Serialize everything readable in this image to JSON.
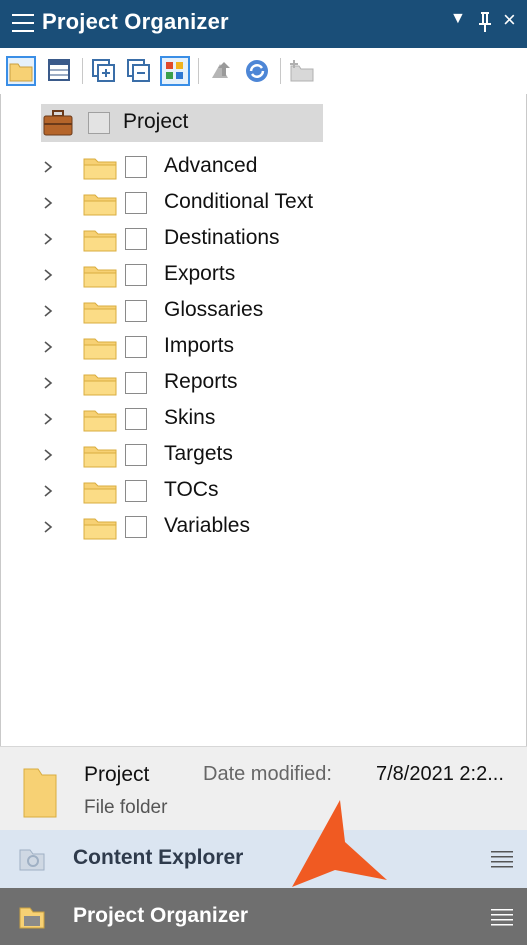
{
  "window": {
    "title": "Project Organizer",
    "dropdown_glyph": "▼",
    "pin_glyph": "⊥",
    "close_glyph": "×"
  },
  "toolbar": {
    "buttons": [
      "open-folder-icon",
      "table-icon",
      "expand-all-icon",
      "collapse-all-icon",
      "color-grid-icon",
      "upload-icon",
      "refresh-icon",
      "new-folder-icon"
    ]
  },
  "tree": {
    "root": {
      "label": "Project"
    },
    "items": [
      {
        "label": "Advanced"
      },
      {
        "label": "Conditional Text"
      },
      {
        "label": "Destinations"
      },
      {
        "label": "Exports"
      },
      {
        "label": "Glossaries"
      },
      {
        "label": "Imports"
      },
      {
        "label": "Reports"
      },
      {
        "label": "Skins"
      },
      {
        "label": "Targets"
      },
      {
        "label": "TOCs"
      },
      {
        "label": "Variables"
      }
    ]
  },
  "details": {
    "name": "Project",
    "date_label": "Date modified:",
    "date_value": "7/8/2021 2:2...",
    "type": "File folder"
  },
  "panes": [
    {
      "label": "Content Explorer",
      "icon": "content-explorer-icon"
    },
    {
      "label": "Project Organizer",
      "icon": "project-organizer-icon"
    }
  ],
  "colors": {
    "titlebar": "#1a4e78",
    "accent_orange": "#f05a22",
    "folder_yellow": "#f7d174"
  }
}
